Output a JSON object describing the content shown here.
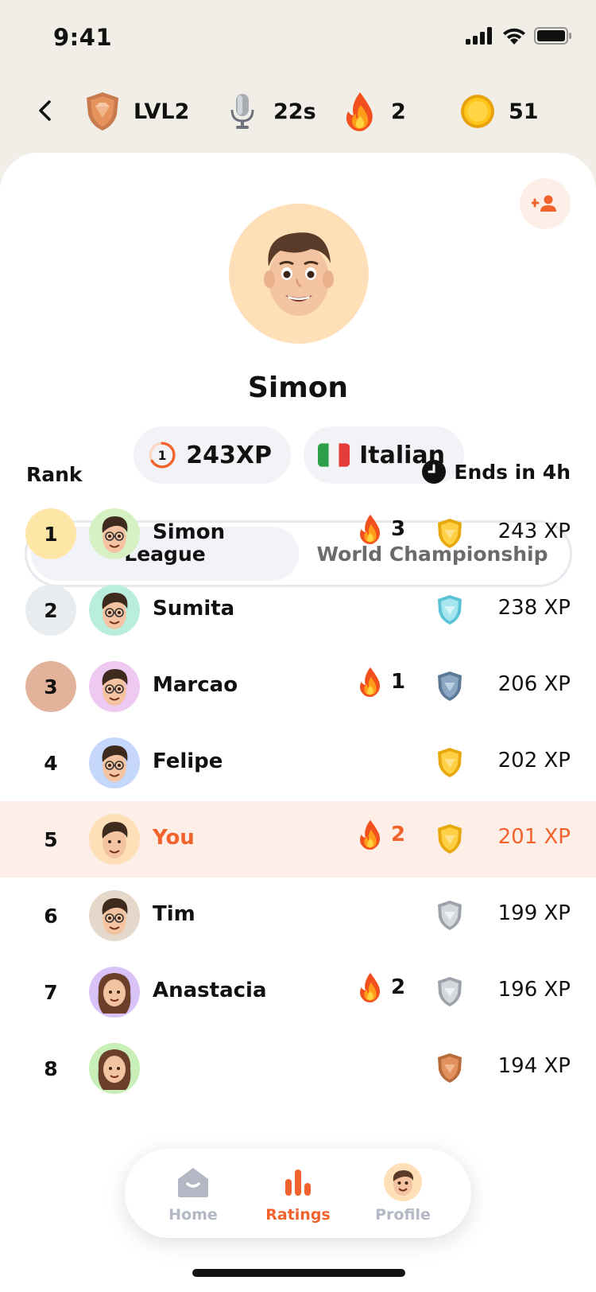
{
  "status": {
    "time": "9:41"
  },
  "top_stats": {
    "level": "LVL2",
    "voice_time": "22s",
    "streak": "2",
    "coins": "51"
  },
  "profile": {
    "name": "Simon",
    "rank_number": "1",
    "xp": "243XP",
    "language": "Italian"
  },
  "tabs": [
    {
      "label": "League",
      "active": true
    },
    {
      "label": "World Championship",
      "active": false
    }
  ],
  "table": {
    "rank_header": "Rank",
    "ends_label": "Ends in 4h"
  },
  "rows": [
    {
      "rank": "1",
      "name": "Simon",
      "streak": "3",
      "shield": "gold",
      "xp": "243 XP",
      "avatar_bg": "#d6f1c4",
      "rank_bg": "#fde6a6"
    },
    {
      "rank": "2",
      "name": "Sumita",
      "streak": "",
      "shield": "diamond",
      "xp": "238 XP",
      "avatar_bg": "#b9eddc",
      "rank_bg": "#e9ecef"
    },
    {
      "rank": "3",
      "name": "Marcao",
      "streak": "1",
      "shield": "steel",
      "xp": "206 XP",
      "avatar_bg": "#eec9f1",
      "rank_bg": "#e2b39a"
    },
    {
      "rank": "4",
      "name": "Felipe",
      "streak": "",
      "shield": "gold",
      "xp": "202 XP",
      "avatar_bg": "#c5d8fb",
      "rank_bg": ""
    },
    {
      "rank": "5",
      "name": "You",
      "streak": "2",
      "shield": "gold",
      "xp": "201 XP",
      "avatar_bg": "#fedfb8",
      "rank_bg": ""
    },
    {
      "rank": "6",
      "name": "Tim",
      "streak": "",
      "shield": "silver",
      "xp": "199 XP",
      "avatar_bg": "#e4d8ca",
      "rank_bg": ""
    },
    {
      "rank": "7",
      "name": "Anastacia",
      "streak": "2",
      "shield": "silver",
      "xp": "196 XP",
      "avatar_bg": "#d8c2f7",
      "rank_bg": ""
    },
    {
      "rank": "8",
      "name": "",
      "streak": "",
      "shield": "bronze",
      "xp": "194 XP",
      "avatar_bg": "#c9efb8",
      "rank_bg": ""
    }
  ],
  "bottom_nav": [
    {
      "label": "Home",
      "icon": "home-icon",
      "active": false
    },
    {
      "label": "Ratings",
      "icon": "ratings-icon",
      "active": true
    },
    {
      "label": "Profile",
      "icon": "profile-avatar-icon",
      "active": false
    }
  ],
  "colors": {
    "accent": "#f2622d",
    "background": "#f1eee8",
    "you_row": "#fdeee7"
  }
}
